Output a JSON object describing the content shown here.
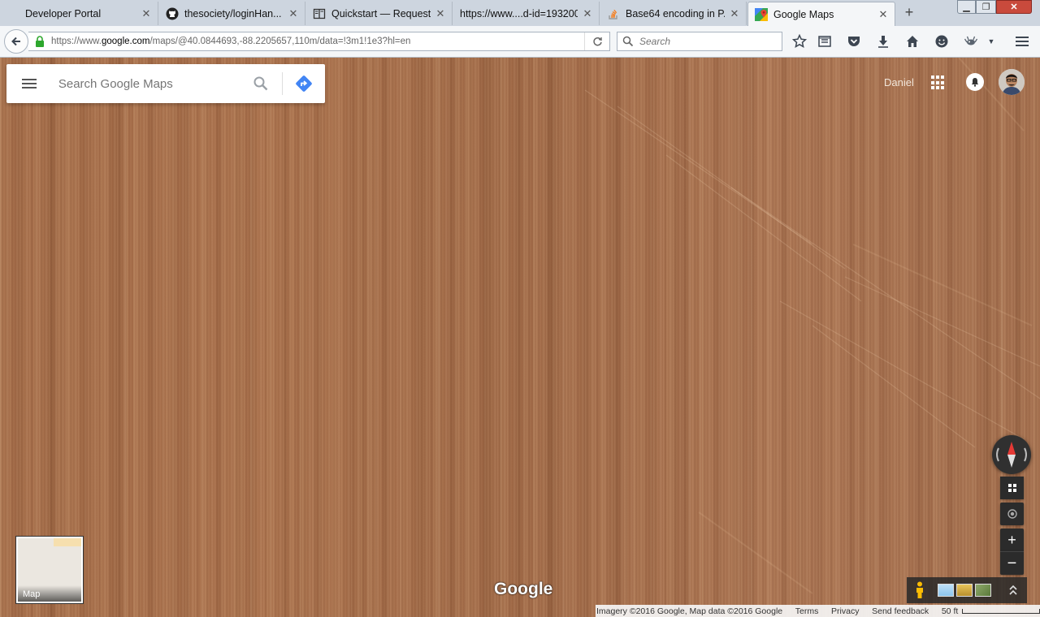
{
  "browser": {
    "tabs": [
      {
        "label": "Developer Portal",
        "icon": "blank-page-icon",
        "active": false
      },
      {
        "label": "thesociety/loginHan...",
        "icon": "github-icon",
        "active": false
      },
      {
        "label": "Quickstart — Request...",
        "icon": "reader-view-icon",
        "active": false
      },
      {
        "label": "https://www....d-id=193200",
        "icon": "blank-page-icon",
        "active": false
      },
      {
        "label": "Base64 encoding in P...",
        "icon": "stackoverflow-icon",
        "active": false
      },
      {
        "label": "Google Maps",
        "icon": "google-maps-icon",
        "active": true
      }
    ],
    "url_prefix": "https://www.",
    "url_host": "google.com",
    "url_path": "/maps/@40.0844693,-88.2205657,110m/data=!3m1!1e3?hl=en",
    "search_placeholder": "Search"
  },
  "maps": {
    "search_placeholder": "Search Google Maps",
    "user_name": "Daniel",
    "minimap_label": "Map",
    "logo_text": "Google",
    "footer": {
      "imagery": "Imagery ©2016 Google, Map data ©2016 Google",
      "terms": "Terms",
      "privacy": "Privacy",
      "feedback": "Send feedback",
      "scale": "50 ft"
    },
    "zoom_in": "+",
    "zoom_out": "−"
  }
}
